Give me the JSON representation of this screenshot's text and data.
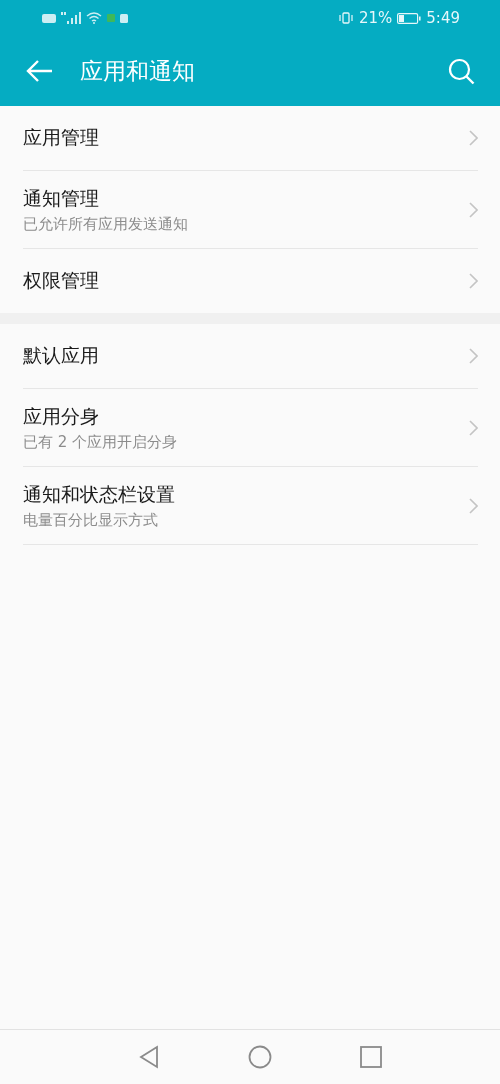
{
  "status_bar": {
    "battery": "21%",
    "time": "5:49"
  },
  "header": {
    "title": "应用和通知"
  },
  "groups": [
    {
      "items": [
        {
          "title": "应用管理"
        },
        {
          "title": "通知管理",
          "subtitle": "已允许所有应用发送通知"
        },
        {
          "title": "权限管理"
        }
      ]
    },
    {
      "items": [
        {
          "title": "默认应用"
        },
        {
          "title": "应用分身",
          "subtitle": "已有 2 个应用开启分身"
        },
        {
          "title": "通知和状态栏设置",
          "subtitle": "电量百分比显示方式"
        }
      ]
    }
  ]
}
